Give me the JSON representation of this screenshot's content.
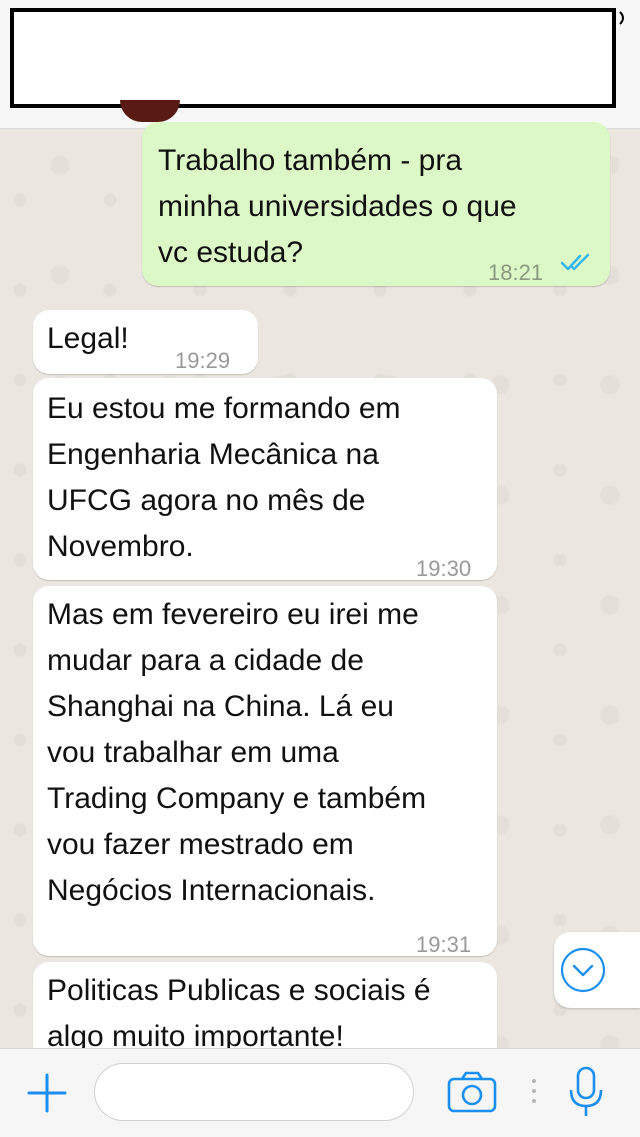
{
  "header": {
    "redacted": true
  },
  "messages": [
    {
      "direction": "outgoing",
      "text": "Trabalho também - pra\nminha universidades o que\nvc estuda?",
      "time": "18:21",
      "status": "read"
    },
    {
      "direction": "incoming",
      "text": "Legal!",
      "time": "19:29"
    },
    {
      "direction": "incoming",
      "text": "Eu estou me formando em\nEngenharia Mecânica na\nUFCG agora no mês de\nNovembro.",
      "time": "19:30"
    },
    {
      "direction": "incoming",
      "text": "Mas em fevereiro eu irei me\nmudar para a cidade de\nShanghai na China. Lá eu\nvou trabalhar em uma\nTrading Company e também\nvou fazer mestrado em\nNegócios Internacionais.",
      "time": "19:31"
    },
    {
      "direction": "incoming",
      "text": "Politicas Publicas e sociais é\nalgo muito importante!",
      "time": ""
    }
  ],
  "colors": {
    "outgoing_bubble": "#dcf8c6",
    "incoming_bubble": "#ffffff",
    "accent": "#1a8ff0",
    "read_ticks": "#34b7f1"
  },
  "icons": {
    "plus": "plus-icon",
    "camera": "camera-icon",
    "mic": "microphone-icon",
    "scroll_down": "chevron-down-icon",
    "read_receipt": "double-check-icon"
  },
  "composer": {
    "value": "",
    "placeholder": ""
  }
}
